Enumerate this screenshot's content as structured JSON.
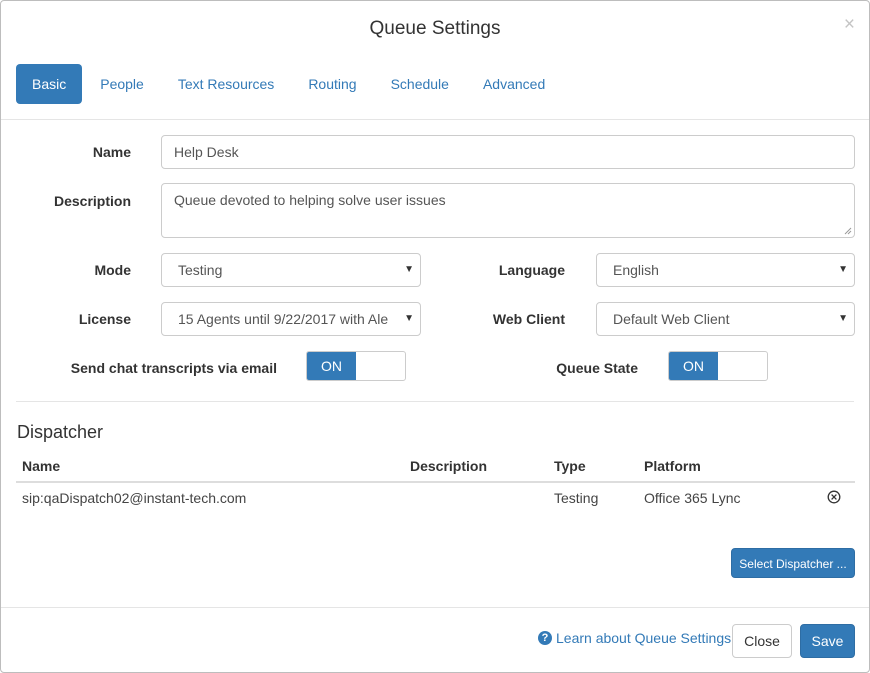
{
  "dialog": {
    "title": "Queue Settings",
    "close_glyph": "×"
  },
  "tabs": [
    {
      "label": "Basic",
      "active": true
    },
    {
      "label": "People",
      "active": false
    },
    {
      "label": "Text Resources",
      "active": false
    },
    {
      "label": "Routing",
      "active": false
    },
    {
      "label": "Schedule",
      "active": false
    },
    {
      "label": "Advanced",
      "active": false
    }
  ],
  "form": {
    "name_label": "Name",
    "name_value": "Help Desk",
    "description_label": "Description",
    "description_value": "Queue devoted to helping solve user issues",
    "mode_label": "Mode",
    "mode_value": "Testing",
    "language_label": "Language",
    "language_value": "English",
    "license_label": "License",
    "license_value": "15 Agents until 9/22/2017 with Ale",
    "web_client_label": "Web Client",
    "web_client_value": "Default Web Client",
    "transcripts_label": "Send chat transcripts via email",
    "transcripts_toggle": "ON",
    "queue_state_label": "Queue State",
    "queue_state_toggle": "ON"
  },
  "dispatcher": {
    "title": "Dispatcher",
    "columns": [
      "Name",
      "Description",
      "Type",
      "Platform"
    ],
    "rows": [
      {
        "name": "sip:qaDispatch02@instant-tech.com",
        "description": "",
        "type": "Testing",
        "platform": "Office 365 Lync"
      }
    ],
    "select_button": "Select Dispatcher ..."
  },
  "footer": {
    "learn_link": "Learn about Queue Settings",
    "help_glyph": "?",
    "close_button": "Close",
    "save_button": "Save"
  },
  "icons": {
    "caret": "chevron-down-icon",
    "remove": "remove-circle-icon",
    "help": "question-circle-icon"
  },
  "colors": {
    "primary": "#337ab7",
    "border": "#cccccc"
  }
}
